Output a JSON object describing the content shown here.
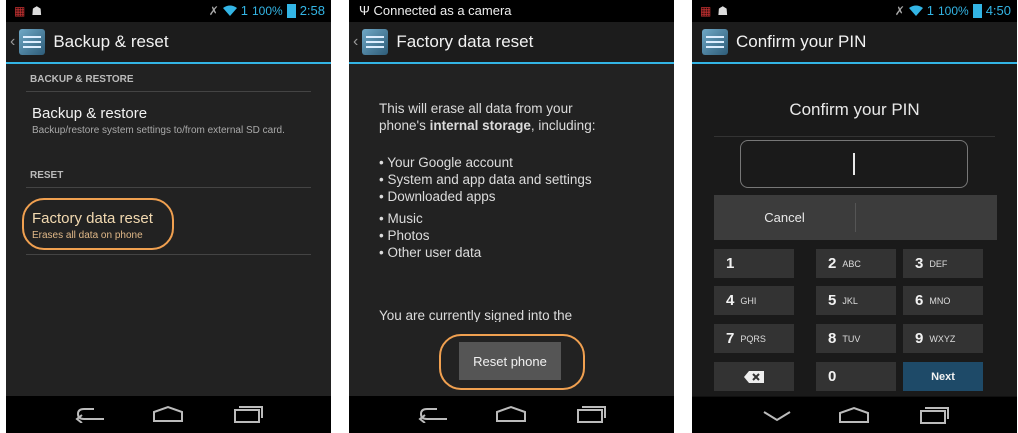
{
  "panel1": {
    "status": {
      "signal": "1",
      "battery": "100%",
      "time": "2:58"
    },
    "title": "Backup & reset",
    "sections": {
      "backup_header": "BACKUP & RESTORE",
      "backup_title": "Backup & restore",
      "backup_summary": "Backup/restore system settings to/from external SD card.",
      "reset_header": "RESET",
      "factory_title": "Factory data reset",
      "factory_summary": "Erases all data on phone"
    }
  },
  "panel2": {
    "status": {
      "notice": "Connected as a camera"
    },
    "title": "Factory data reset",
    "intro_1": "This will erase all data from your",
    "intro_2_pre": "phone's ",
    "intro_2_bold": "internal storage",
    "intro_2_post": ", including:",
    "bullets": [
      "• Your Google account",
      "• System and app data and settings",
      "• Downloaded apps",
      "• Music",
      "• Photos",
      "• Other user data"
    ],
    "signed_in": "You are currently signed into the",
    "reset_button": "Reset phone"
  },
  "panel3": {
    "status": {
      "signal": "1",
      "battery": "100%",
      "time": "4:50"
    },
    "title": "Confirm your PIN",
    "heading": "Confirm your PIN",
    "cancel": "Cancel",
    "keys": {
      "k1": "1",
      "k2": "2",
      "k2s": "ABC",
      "k3": "3",
      "k3s": "DEF",
      "k4": "4",
      "k4s": "GHI",
      "k5": "5",
      "k5s": "JKL",
      "k6": "6",
      "k6s": "MNO",
      "k7": "7",
      "k7s": "PQRS",
      "k8": "8",
      "k8s": "TUV",
      "k9": "9",
      "k9s": "WXYZ",
      "k0": "0",
      "next": "Next"
    }
  },
  "colors": {
    "accent": "#33b5e5",
    "highlight": "#f0a050",
    "next_key": "#1e4a68"
  },
  "icons": [
    "back-icon",
    "home-icon",
    "recents-icon",
    "usb-icon",
    "wifi-icon",
    "battery-icon",
    "delete-key-icon",
    "settings-app-icon",
    "hide-keyboard-icon"
  ]
}
